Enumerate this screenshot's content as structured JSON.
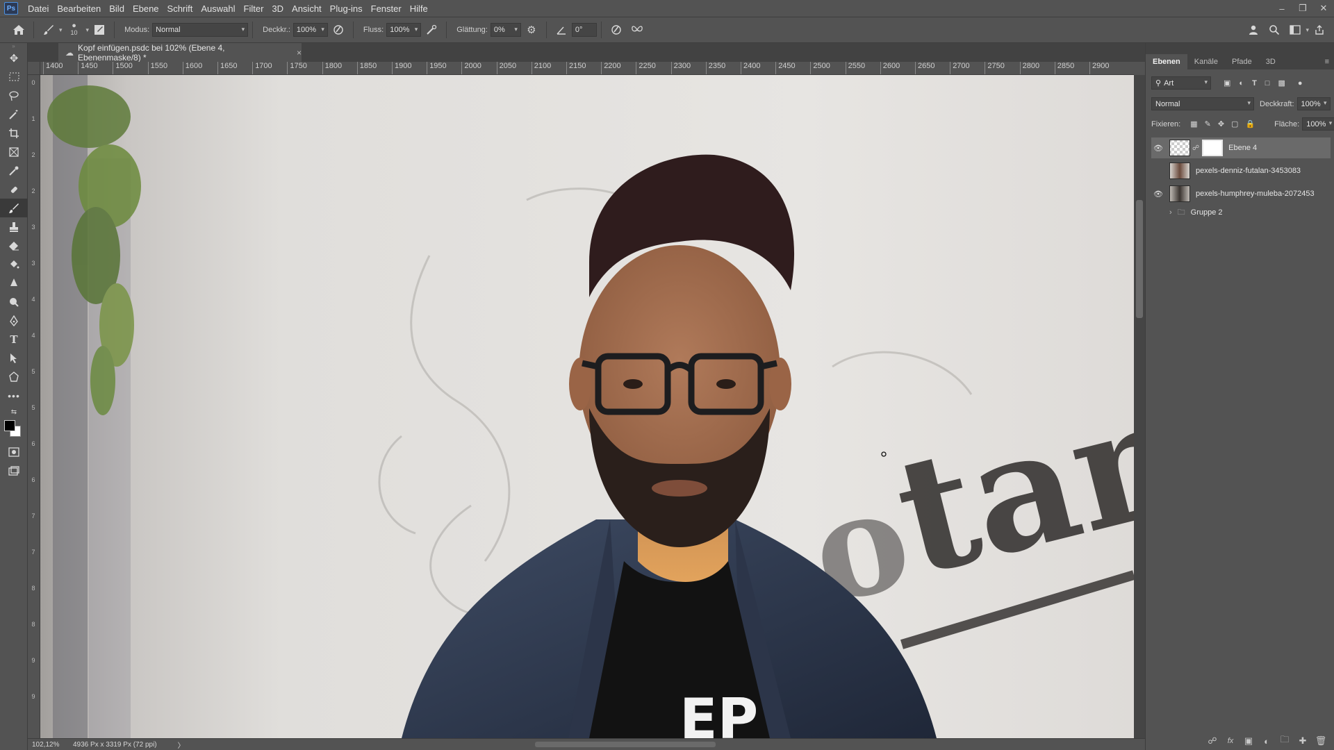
{
  "app": {
    "logo": "Ps",
    "menu": [
      "Datei",
      "Bearbeiten",
      "Bild",
      "Ebene",
      "Schrift",
      "Auswahl",
      "Filter",
      "3D",
      "Ansicht",
      "Plug-ins",
      "Fenster",
      "Hilfe"
    ],
    "window_buttons": [
      "minimize-icon",
      "restore-icon",
      "close-icon"
    ]
  },
  "options": {
    "brush_size": "10",
    "modus_label": "Modus:",
    "modus_value": "Normal",
    "deckkr_label": "Deckkr.:",
    "deckkr_value": "100%",
    "fluss_label": "Fluss:",
    "fluss_value": "100%",
    "glaettung_label": "Glättung:",
    "glaettung_value": "0%",
    "angle_value": "0°"
  },
  "document": {
    "tab_title": "Kopf einfügen.psdc bei 102% (Ebene 4, Ebenenmaske/8) *",
    "close": "×"
  },
  "ruler": {
    "h_ticks": [
      "1400",
      "1450",
      "1500",
      "1550",
      "1600",
      "1650",
      "1700",
      "1750",
      "1800",
      "1850",
      "1900",
      "1950",
      "2000",
      "2050",
      "2100",
      "2150",
      "2200",
      "2250",
      "2300",
      "2350",
      "2400",
      "2450",
      "2500",
      "2550",
      "2600",
      "2650",
      "2700",
      "2750",
      "2800",
      "2850",
      "2900"
    ],
    "v_ticks": [
      "0",
      "1",
      "2",
      "2",
      "3",
      "3",
      "4",
      "4",
      "5",
      "5",
      "6",
      "6",
      "7",
      "7",
      "8",
      "8",
      "9",
      "9"
    ]
  },
  "status": {
    "zoom": "102,12%",
    "doc_info": "4936 Px x 3319 Px (72 ppi)",
    "arrow": "〉"
  },
  "panel": {
    "tabs": [
      "Ebenen",
      "Kanäle",
      "Pfade",
      "3D"
    ],
    "filter_label": "Art",
    "blend_mode": "Normal",
    "opacity_label": "Deckkraft:",
    "opacity_value": "100%",
    "lock_label": "Fixieren:",
    "fill_label": "Fläche:",
    "fill_value": "100%",
    "layers": [
      {
        "name": "Ebene 4",
        "visible": true,
        "selected": true
      },
      {
        "name": "pexels-denniz-futalan-3453083",
        "visible": false,
        "selected": false
      },
      {
        "name": "pexels-humphrey-muleba-2072453",
        "visible": true,
        "selected": false
      },
      {
        "name": "Gruppe 2",
        "visible": false,
        "selected": false
      }
    ]
  },
  "colors": {
    "ui_bg": "#535353",
    "panel_dark": "#424242",
    "selected_layer": "#6a6a6a",
    "ps_blue": "#4a90e2"
  }
}
